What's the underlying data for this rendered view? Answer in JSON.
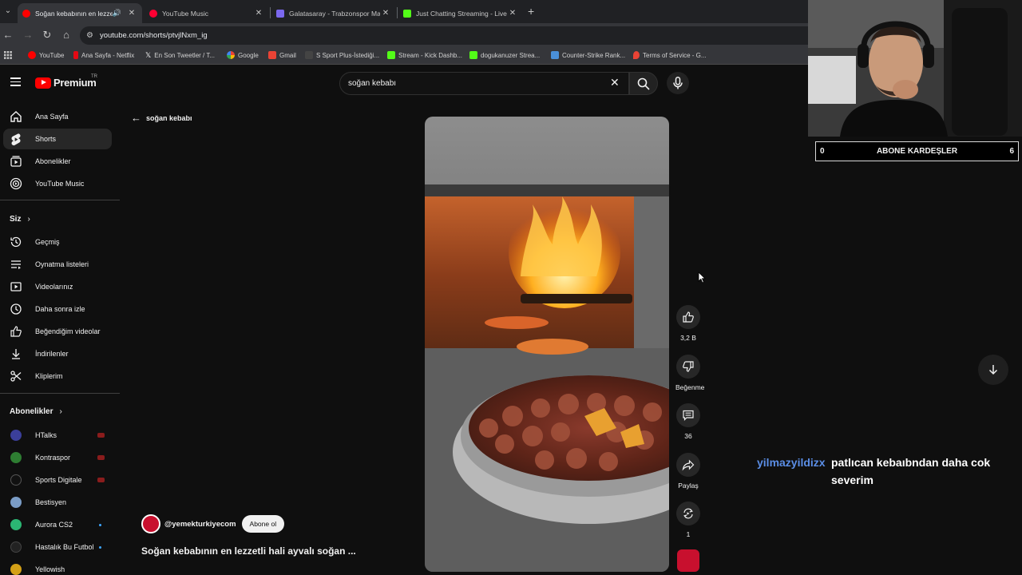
{
  "browser": {
    "tabs": [
      {
        "title": "Soğan kebabının en lezzetli",
        "active": true
      },
      {
        "title": "YouTube Music",
        "active": false
      },
      {
        "title": "Galatasaray - Trabzonspor Maç",
        "active": false
      },
      {
        "title": "Just Chatting Streaming - Live",
        "active": false
      }
    ],
    "url": "youtube.com/shorts/ptvjlNxm_ig",
    "bookmarks": [
      "YouTube",
      "Ana Sayfa - Netflix",
      "En Son Tweetler / T...",
      "Google",
      "Gmail",
      "S Sport Plus-İstediği...",
      "Stream - Kick Dashb...",
      "dogukanuzer Strea...",
      "Counter-Strike Rank...",
      "Terms of Service - G..."
    ]
  },
  "masthead": {
    "logo": "Premium",
    "country": "TR",
    "search_value": "soğan kebabı"
  },
  "sidebar": {
    "main": [
      {
        "label": "Ana Sayfa",
        "icon": "home-icon"
      },
      {
        "label": "Shorts",
        "icon": "shorts-icon",
        "selected": true
      },
      {
        "label": "Abonelikler",
        "icon": "subscriptions-icon"
      },
      {
        "label": "YouTube Music",
        "icon": "music-icon"
      }
    ],
    "you_header": "Siz",
    "you": [
      {
        "label": "Geçmiş",
        "icon": "history-icon"
      },
      {
        "label": "Oynatma listeleri",
        "icon": "playlist-icon"
      },
      {
        "label": "Videolarınız",
        "icon": "your-videos-icon"
      },
      {
        "label": "Daha sonra izle",
        "icon": "watch-later-icon"
      },
      {
        "label": "Beğendiğim videolar",
        "icon": "liked-icon"
      },
      {
        "label": "İndirilenler",
        "icon": "download-icon"
      },
      {
        "label": "Kliplerim",
        "icon": "clips-icon"
      }
    ],
    "subs_header": "Abonelikler",
    "subscriptions": [
      {
        "label": "HTalks",
        "color": "#3b3f9a",
        "badge": "live"
      },
      {
        "label": "Kontraspor",
        "color": "#2e7d32",
        "badge": "live"
      },
      {
        "label": "Sports Digitale",
        "color": "#111111",
        "badge": "live"
      },
      {
        "label": "Bestisyen",
        "color": "#7a9cc6",
        "badge": ""
      },
      {
        "label": "Aurora CS2",
        "color": "#2bb673",
        "badge": "new"
      },
      {
        "label": "Hastalık Bu Futbol",
        "color": "#222222",
        "badge": "new"
      },
      {
        "label": "Yellowish",
        "color": "#d4a017",
        "badge": ""
      }
    ]
  },
  "main": {
    "back_label": "soğan kebabı",
    "channel": "@yemekturkiyecom",
    "subscribe_label": "Abone ol",
    "title": "Soğan kebabının en lezzetli hali ayvalı soğan ...",
    "actions": [
      {
        "icon": "like-icon",
        "label": "3,2 B"
      },
      {
        "icon": "dislike-icon",
        "label": "Beğenme"
      },
      {
        "icon": "comment-icon",
        "label": "36"
      },
      {
        "icon": "share-icon",
        "label": "Paylaş"
      },
      {
        "icon": "remix-icon",
        "label": "1"
      }
    ]
  },
  "overlay": {
    "counter_left": "0",
    "counter_title": "ABONE KARDEŞLER",
    "counter_right": "6",
    "chat_user": "yilmazyildizx",
    "chat_message": "patlıcan kebaıbndan daha cok severim"
  },
  "colors": {
    "accent": "#ff0000",
    "background": "#0f0f0f",
    "chat_user": "#5b8ee6"
  }
}
